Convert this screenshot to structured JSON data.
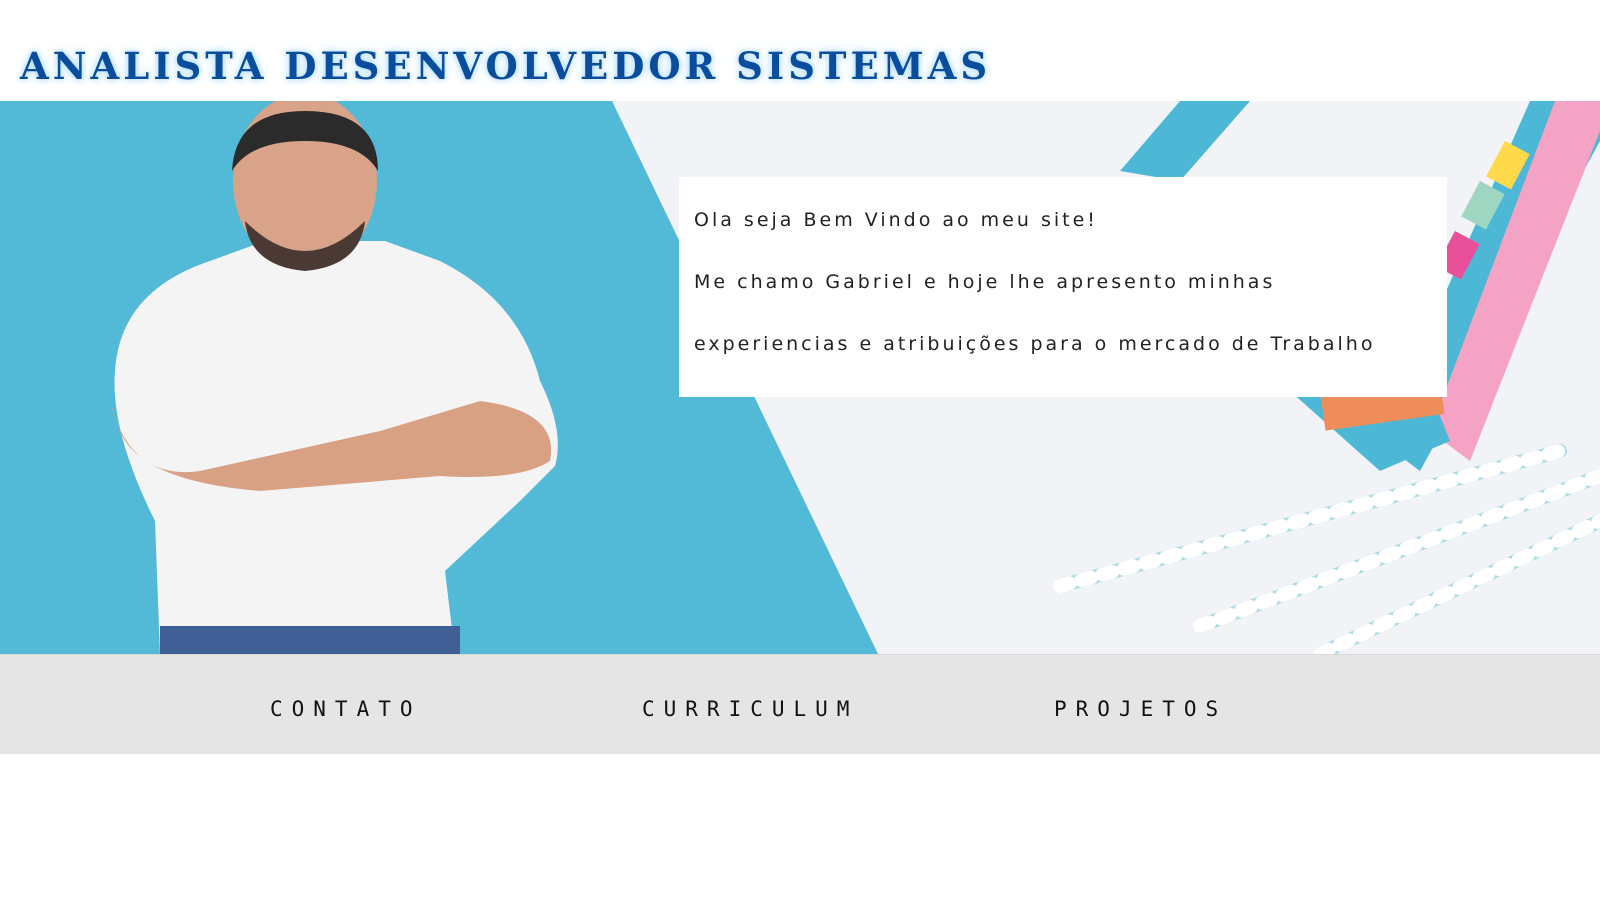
{
  "header": {
    "title": "ANALISTA DESENVOLVEDOR SISTEMAS"
  },
  "hero": {
    "welcome_lines": [
      "Ola seja Bem Vindo ao meu site!",
      "Me chamo Gabriel e hoje lhe apresento minhas",
      "experiencias e atribuições para o mercado de Trabalho"
    ]
  },
  "nav": {
    "items": [
      {
        "label": "CONTATO"
      },
      {
        "label": "CURRICULUM"
      },
      {
        "label": "PROJETOS"
      }
    ]
  },
  "colors": {
    "title": "#0a4d9c",
    "hero_blue": "#52b9d6",
    "nav_bg": "#e5e5e5"
  }
}
